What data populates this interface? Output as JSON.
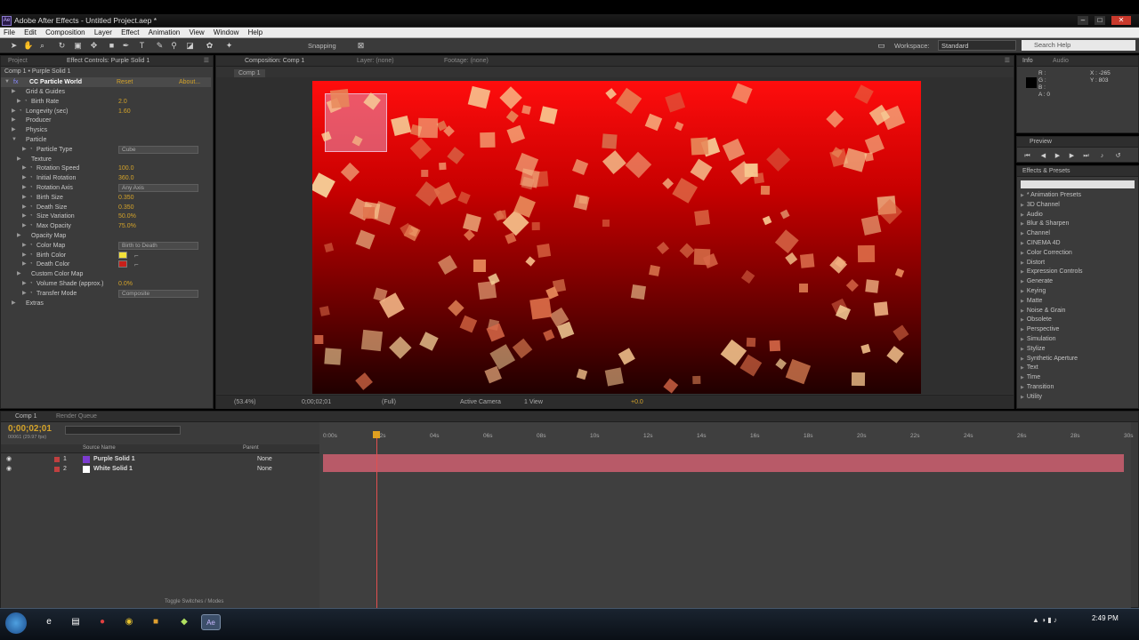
{
  "window": {
    "app_badge": "Ae",
    "title": "Adobe After Effects - Untitled Project.aep *",
    "min": "–",
    "max": "□",
    "close": "✕"
  },
  "menu": [
    "File",
    "Edit",
    "Composition",
    "Layer",
    "Effect",
    "Animation",
    "View",
    "Window",
    "Help"
  ],
  "toolbar": {
    "snapping": "Snapping",
    "workspace_label": "Workspace:",
    "workspace_value": "Standard",
    "search_placeholder": "Search Help"
  },
  "effect_panel": {
    "tab_project": "Project",
    "tab_effect": "Effect Controls: Purple Solid 1",
    "comp_path": "Comp 1 • Purple Solid 1",
    "effect_name": "CC Particle World",
    "reset": "Reset",
    "about": "About...",
    "rows": [
      {
        "label": "Grid & Guides",
        "indent": 1
      },
      {
        "label": "Birth Rate",
        "indent": 2,
        "value": "2.0"
      },
      {
        "label": "Longevity (sec)",
        "indent": 1,
        "value": "1.60"
      },
      {
        "label": "Producer",
        "indent": 1
      },
      {
        "label": "Physics",
        "indent": 1
      },
      {
        "label": "Particle",
        "indent": 1
      },
      {
        "label": "Particle Type",
        "indent": 3,
        "dropdown": "Cube"
      },
      {
        "label": "Texture",
        "indent": 2
      },
      {
        "label": "Rotation Speed",
        "indent": 3,
        "value": "100.0"
      },
      {
        "label": "Initial Rotation",
        "indent": 3,
        "value": "360.0"
      },
      {
        "label": "Rotation Axis",
        "indent": 3,
        "dropdown": "Any Axis"
      },
      {
        "label": "Birth Size",
        "indent": 3,
        "value": "0.350"
      },
      {
        "label": "Death Size",
        "indent": 3,
        "value": "0.350"
      },
      {
        "label": "Size Variation",
        "indent": 3,
        "value": "50.0%"
      },
      {
        "label": "Max Opacity",
        "indent": 3,
        "value": "75.0%"
      },
      {
        "label": "Opacity Map",
        "indent": 2
      },
      {
        "label": "Color Map",
        "indent": 3,
        "dropdown": "Birth to Death"
      },
      {
        "label": "Birth Color",
        "indent": 3,
        "swatch": "#f3e13a"
      },
      {
        "label": "Death Color",
        "indent": 3,
        "swatch": "#c8201a"
      },
      {
        "label": "Custom Color Map",
        "indent": 2
      },
      {
        "label": "Volume Shade (approx.)",
        "indent": 3,
        "value": "0.0%"
      },
      {
        "label": "Transfer Mode",
        "indent": 3,
        "dropdown": "Composite"
      },
      {
        "label": "Extras",
        "indent": 1
      }
    ]
  },
  "composition": {
    "tab": "Composition: Comp 1",
    "layer_tab": "Layer: (none)",
    "footage_tab": "Footage: (none)",
    "sub_tab": "Comp 1",
    "zoom": "(53.4%)",
    "timecode": "0;00;02;01",
    "resolution": "(Full)",
    "camera": "Active Camera",
    "views": "1 View",
    "exposure": "+0.0"
  },
  "info": {
    "tab": "Info",
    "audio_tab": "Audio",
    "rgba": [
      "R :",
      "G :",
      "B :",
      "A : 0"
    ],
    "x": "X : -265",
    "y": "Y : 803"
  },
  "preview": {
    "tab": "Preview"
  },
  "effects_presets": {
    "tab": "Effects & Presets",
    "items": [
      "* Animation Presets",
      "3D Channel",
      "Audio",
      "Blur & Sharpen",
      "Channel",
      "CINEMA 4D",
      "Color Correction",
      "Distort",
      "Expression Controls",
      "Generate",
      "Keying",
      "Matte",
      "Noise & Grain",
      "Obsolete",
      "Perspective",
      "Simulation",
      "Stylize",
      "Synthetic Aperture",
      "Text",
      "Time",
      "Transition",
      "Utility"
    ]
  },
  "timeline": {
    "tab": "Comp 1",
    "render_tab": "Render Queue",
    "timecode": "0;00;02;01",
    "frames": "00061 (29.97 fps)",
    "col_source": "Source Name",
    "col_parent": "Parent",
    "layers": [
      {
        "num": "1",
        "name": "Purple Solid 1",
        "color": "#7c3cd0",
        "parent": "None"
      },
      {
        "num": "2",
        "name": "White Solid 1",
        "color": "#ffffff",
        "parent": "None"
      }
    ],
    "ticks": [
      "0:00s",
      "02s",
      "04s",
      "06s",
      "08s",
      "10s",
      "12s",
      "14s",
      "16s",
      "18s",
      "20s",
      "22s",
      "24s",
      "26s",
      "28s",
      "30s"
    ],
    "toggle": "Toggle Switches / Modes"
  },
  "taskbar": {
    "time": "2:49 PM"
  }
}
